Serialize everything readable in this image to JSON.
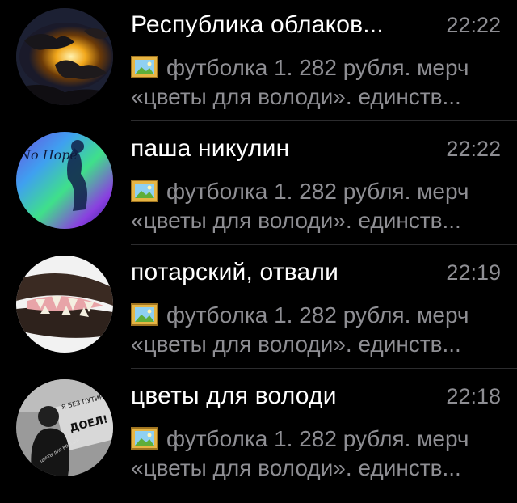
{
  "chats": [
    {
      "title": "Республика облаков...",
      "time": "22:22",
      "preview_line1": "футболка 1. 282 рубля. мерч",
      "preview_line2": "«цветы для володи». единств...",
      "avatar": "sunset-clouds-avatar"
    },
    {
      "title": "паша никулин",
      "time": "22:22",
      "preview_line1": "футболка 1. 282 рубля. мерч",
      "preview_line2": "«цветы для володи». единств...",
      "avatar": "no-hope-gradient-avatar",
      "avatar_text": "No Hope"
    },
    {
      "title": "потарский, отвали",
      "time": "22:19",
      "preview_line1": "футболка 1. 282 рубля. мерч",
      "preview_line2": "«цветы для володи». единств...",
      "avatar": "wolf-teeth-avatar"
    },
    {
      "title": "цветы для володи",
      "time": "22:18",
      "preview_line1": "футболка 1. 282 рубля. мерч",
      "preview_line2": "«цветы для володи». единств...",
      "avatar": "bw-person-avatar",
      "avatar_text": [
        "Я БЕЗ ПУТИНА",
        "ДОЕЛ!",
        "ЦВЕТЫ ДЛЯ ВОЛОДИ"
      ]
    }
  ],
  "colors": {
    "background": "#000000",
    "title": "#ffffff",
    "secondary": "#8e8e93",
    "divider": "#2c2c2e"
  }
}
